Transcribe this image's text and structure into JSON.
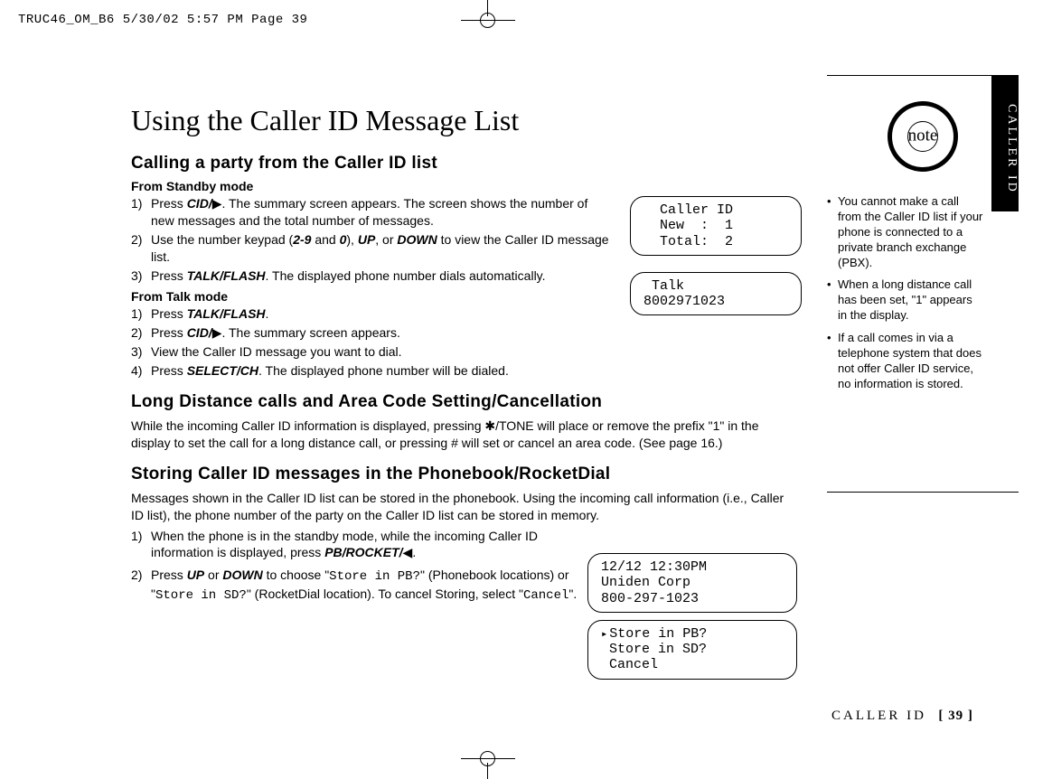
{
  "header_strip": "TRUC46_OM_B6  5/30/02  5:57 PM  Page 39",
  "title": "Using the Caller ID Message List",
  "section1": {
    "heading": "Calling a party from the Caller ID list",
    "mode1_label": "From Standby mode",
    "mode1_steps": [
      {
        "n": "1)",
        "pre": "Press ",
        "btn": "CID/",
        "post": "▶. The summary screen appears. The screen shows the number of new messages and the total number of messages."
      },
      {
        "n": "2)",
        "pre": "Use the number keypad (",
        "btn": "2-9",
        "mid": " and ",
        "btn2": "0",
        "mid2": "), ",
        "btn3": "UP",
        "mid3": ", or ",
        "btn4": "DOWN",
        "post": " to view the Caller ID message list."
      },
      {
        "n": "3)",
        "pre": "Press ",
        "btn": "TALK/FLASH",
        "post": ". The displayed phone number dials automatically."
      }
    ],
    "mode2_label": "From Talk mode",
    "mode2_steps": [
      {
        "n": "1)",
        "pre": "Press ",
        "btn": "TALK/FLASH",
        "post": "."
      },
      {
        "n": "2)",
        "pre": "Press ",
        "btn": "CID/",
        "post": "▶. The summary screen appears."
      },
      {
        "n": "3)",
        "pre": "View the Caller ID message you want to dial.",
        "btn": "",
        "post": ""
      },
      {
        "n": "4)",
        "pre": "Press ",
        "btn": "SELECT/CH",
        "post": ". The displayed phone number will be dialed."
      }
    ]
  },
  "section2": {
    "heading": "Long Distance calls and Area Code Setting/Cancellation",
    "body": "While the incoming Caller ID information is displayed, pressing ✱/TONE will place or remove the prefix \"1\" in the display to set the call for a long distance call, or pressing # will set or cancel an area code. (See page 16.)"
  },
  "section3": {
    "heading": "Storing Caller ID messages in the Phonebook/RocketDial",
    "intro": "Messages shown in the Caller ID list can be stored in the phonebook. Using the incoming call information (i.e., Caller ID list), the phone number of the party on the Caller ID list can be stored in memory.",
    "step1": {
      "n": "1)",
      "pre": "When the phone is in the standby mode, while the incoming Caller ID information is displayed, press ",
      "btn": "PB/ROCKET/",
      "post": "◀."
    },
    "step2": {
      "n": "2)",
      "pre": "Press ",
      "btn": "UP",
      "mid": " or ",
      "btn2": "DOWN",
      "mid2": " to choose \"",
      "d1": "Store in PB?",
      "mid3": "\" (Phonebook locations) or \"",
      "d2": "Store in SD?",
      "mid4": "\" (RocketDial location). To cancel Storing, select \"",
      "d3": "Cancel",
      "post": "\"."
    }
  },
  "lcd1": "  Caller ID\n  New  :  1\n  Total:  2",
  "lcd2": " Talk\n8002971023",
  "lcd3": "12/12 12:30PM\nUniden Corp\n800-297-1023",
  "lcd4_line1": "Store in PB?",
  "lcd4_line2": " Store in SD?",
  "lcd4_line3": " Cancel",
  "sidebar": {
    "tab": "CALLER ID",
    "note_label": "note",
    "notes": [
      "You cannot make a call from the Caller ID list if your phone is connected to a private branch exchange (PBX).",
      "When a long distance call has been set, \"1\" appears in the display.",
      "If a call comes in via a telephone system that does not offer Caller ID service, no information is stored."
    ]
  },
  "footer": {
    "section": "CALLER ID",
    "page": "[ 39 ]"
  }
}
